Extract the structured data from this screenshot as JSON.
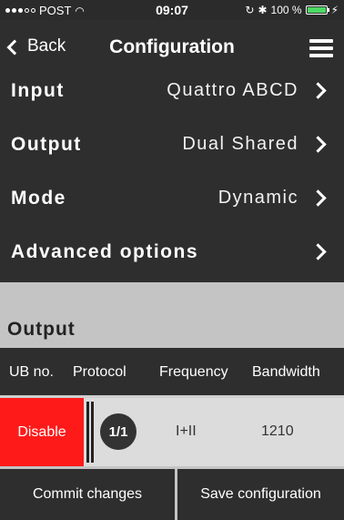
{
  "status_bar": {
    "carrier": "POST",
    "time": "09:07",
    "battery_percent": "100 %",
    "battery_level": 1.0
  },
  "nav": {
    "back_label": "Back",
    "title": "Configuration"
  },
  "settings": {
    "input": {
      "label": "Input",
      "value": "Quattro ABCD"
    },
    "output": {
      "label": "Output",
      "value": "Dual Shared"
    },
    "mode": {
      "label": "Mode",
      "value": "Dynamic"
    },
    "advanced": {
      "label": "Advanced options"
    }
  },
  "output_section": {
    "title": "Output",
    "columns": [
      "UB no.",
      "Protocol",
      "Frequency",
      "Bandwidth"
    ],
    "rows": [
      {
        "action": "Disable",
        "ub_no": "1/1",
        "frequency": "I+II",
        "bandwidth": "1210"
      }
    ]
  },
  "actions": {
    "commit_label": "Commit changes",
    "save_label": "Save configuration"
  },
  "colors": {
    "background": "#2e2e2e",
    "section_gray": "#c4c4c4",
    "disable_red": "#ff1a1a",
    "battery_green": "#4cd964"
  }
}
